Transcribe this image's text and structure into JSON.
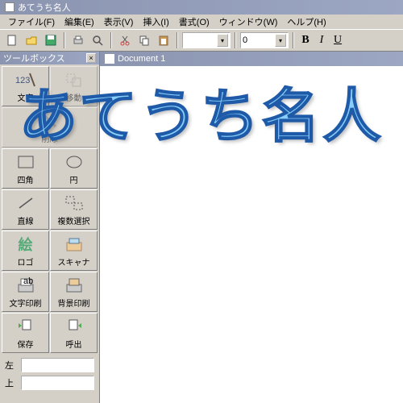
{
  "app": {
    "title": "あてうち名人"
  },
  "menu": {
    "file": "ファイル(F)",
    "edit": "編集(E)",
    "view": "表示(V)",
    "insert": "挿入(I)",
    "format": "書式(O)",
    "window": "ウィンドウ(W)",
    "help": "ヘルプ(H)"
  },
  "toolbar": {
    "combo1": "",
    "combo2": "0",
    "bold": "B",
    "italic": "I",
    "underline": "U"
  },
  "toolbox": {
    "title": "ツールボックス",
    "tools": {
      "text": "文字",
      "move": "移動",
      "delete": "削除",
      "rect": "四角",
      "circle": "円",
      "line": "直線",
      "multisel": "複数選択",
      "logo": "ロゴ",
      "scanner": "スキャナ",
      "textprint": "文字印刷",
      "bgprint": "背景印刷",
      "save": "保存",
      "load": "呼出"
    },
    "left": "左",
    "top": "上"
  },
  "document": {
    "title": "Document 1"
  },
  "overlay_text": "あてうち名人"
}
